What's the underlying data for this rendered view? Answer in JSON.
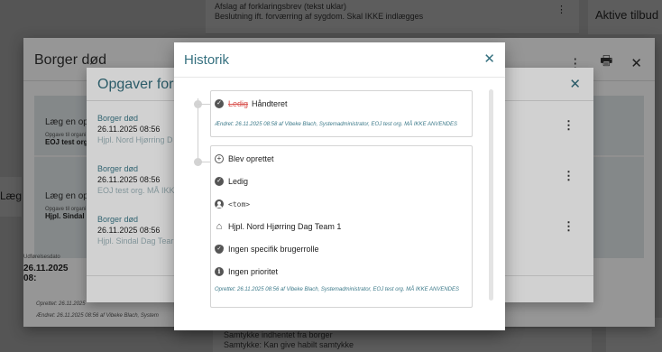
{
  "base": {
    "top_card_line1": "Afslag af forklaringsbrev (tekst uklar)",
    "top_card_line2": "Beslutning ift. forværring af sygdom. Skal IKKE indlægges",
    "top_kebab": "⋮",
    "right_card": "Aktive tilbud",
    "left_fragment": "Læg af",
    "bottom_card_line1": "Samtykke indhentet fra borger",
    "bottom_card_line2": "Samtykke: Kan give habilt samtykke"
  },
  "borger": {
    "title": "Borger død",
    "kebab": "⋮",
    "print_icon": "🖶",
    "close": "✕",
    "item1_label": "Læg en opga",
    "item1_small": "Opgave til organi",
    "item1_strong": "EOJ test org.",
    "item2_label": "Læg en opga",
    "item2_small": "Opgave til organi",
    "item2_strong": "Hjpl. Sindal D",
    "foot_label": "Udførelsesdato",
    "foot_value": "26.11.2025 08:",
    "created": "Oprettet: 26.11.2025",
    "changed": "Ændret: 26.11.2025 08:56 af Vibeke Blach, System"
  },
  "opgaver": {
    "title": "Opgaver for o",
    "close": "✕",
    "kebab": "⋮",
    "items": [
      {
        "type": "Borger død",
        "date": "26.11.2025 08:56",
        "org": "Hjpl. Nord Hjørring D"
      },
      {
        "type": "Borger død",
        "date": "26.11.2025 08:56",
        "org": "EOJ test org. MÅ IKK"
      },
      {
        "type": "Borger død",
        "date": "26.11.2025 08:56",
        "org": "Hjpl. Sindal Dag Tear"
      }
    ]
  },
  "historik": {
    "title": "Historik",
    "close": "✕",
    "entry1": {
      "old_status": "Ledig",
      "new_status": "Håndteret",
      "changed": "Ændret: 26.11.2025 08:58 af Vibeke Blach, Systemadministrator, EOJ test org. MÅ IKKE ANVENDES"
    },
    "entry2": {
      "created_label": "Blev oprettet",
      "status": "Ledig",
      "assignee": "<tom>",
      "organisation": "Hjpl. Nord Hjørring Dag Team 1",
      "role": "Ingen specifik brugerrolle",
      "priority": "Ingen prioritet",
      "created": "Oprettet: 26.11.2025 08:56 af Vibeke Blach, Systemadministrator, EOJ test org. MÅ IKKE ANVENDES"
    }
  }
}
